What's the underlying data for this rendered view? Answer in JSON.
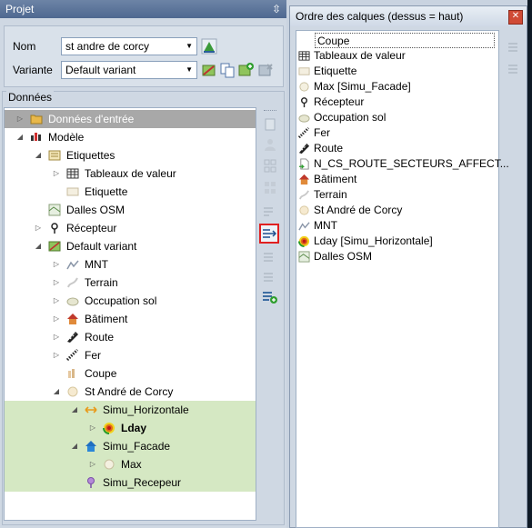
{
  "left_panel": {
    "title": "Projet",
    "pin_glyph": "⇳",
    "nom_label": "Nom",
    "nom_value": "st andre de corcy",
    "variante_label": "Variante",
    "variante_value": "Default variant",
    "donnees_label": "Données"
  },
  "tree": [
    {
      "label": "Données d'entrée",
      "bold": false,
      "icon": "folder-icon"
    },
    {
      "label": "Modèle",
      "icon": "model-icon"
    },
    {
      "label": "Etiquettes",
      "icon": "labels-icon"
    },
    {
      "label": "Tableaux de valeur",
      "icon": "table-icon"
    },
    {
      "label": "Etiquette",
      "icon": "label-icon"
    },
    {
      "label": "Dalles OSM",
      "icon": "osm-tiles-icon"
    },
    {
      "label": "Récepteur",
      "icon": "receiver-icon"
    },
    {
      "label": "Default variant",
      "icon": "variant-icon"
    },
    {
      "label": "MNT",
      "icon": "dem-icon"
    },
    {
      "label": "Terrain",
      "icon": "terrain-icon"
    },
    {
      "label": "Occupation sol",
      "icon": "land-use-icon"
    },
    {
      "label": "Bâtiment",
      "icon": "building-icon"
    },
    {
      "label": "Route",
      "icon": "road-icon"
    },
    {
      "label": "Fer",
      "icon": "rail-icon"
    },
    {
      "label": "Coupe",
      "icon": "section-icon"
    },
    {
      "label": "St André de Corcy",
      "icon": "site-icon"
    },
    {
      "label": "Simu_Horizontale",
      "icon": "horizontal-simulation-icon"
    },
    {
      "label": "Lday",
      "icon": "lday-icon"
    },
    {
      "label": "Simu_Facade",
      "icon": "facade-simulation-icon"
    },
    {
      "label": "Max",
      "icon": "max-icon"
    },
    {
      "label": "Simu_Recepeur",
      "icon": "receiver-simulation-icon"
    }
  ],
  "right_panel": {
    "title": "Ordre des calques (dessus = haut)",
    "close_glyph": "✕",
    "layers": [
      {
        "label": "Coupe",
        "icon": "section-icon"
      },
      {
        "label": "Tableaux de valeur",
        "icon": "table-icon"
      },
      {
        "label": "Etiquette",
        "icon": "label-icon"
      },
      {
        "label": "Max [Simu_Facade]",
        "icon": "max-icon"
      },
      {
        "label": "Récepteur",
        "icon": "receiver-icon"
      },
      {
        "label": "Occupation sol",
        "icon": "land-use-icon"
      },
      {
        "label": "Fer",
        "icon": "rail-icon"
      },
      {
        "label": "Route",
        "icon": "road-icon"
      },
      {
        "label": "N_CS_ROUTE_SECTEURS_AFFECT...",
        "icon": "document-icon"
      },
      {
        "label": "Bâtiment",
        "icon": "building-icon"
      },
      {
        "label": "Terrain",
        "icon": "terrain-icon"
      },
      {
        "label": "St André de Corcy",
        "icon": "site-icon"
      },
      {
        "label": "MNT",
        "icon": "dem-icon"
      },
      {
        "label": "Lday [Simu_Horizontale]",
        "icon": "lday-icon"
      },
      {
        "label": "Dalles OSM",
        "icon": "osm-tiles-icon"
      }
    ]
  },
  "colors": {
    "titlebar": "#56708f",
    "selection_green": "#d5e8c3",
    "header_grey": "#a6a6a6",
    "highlight_red": "#e02020"
  }
}
